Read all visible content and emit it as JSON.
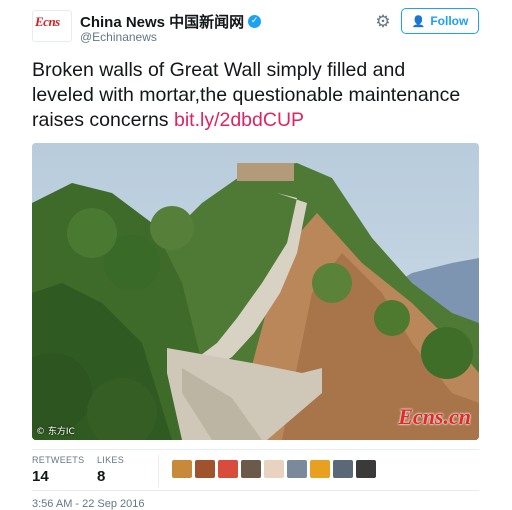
{
  "tweet": {
    "author": {
      "avatar_text": "Ecns",
      "display_name": "China News 中国新闻网",
      "handle": "@Echinanews",
      "verified_icon": "✓"
    },
    "follow_label": "Follow",
    "text": "Broken walls of Great Wall simply filled and leveled with mortar,the questionable maintenance raises concerns ",
    "link": "bit.ly/2dbdCUP",
    "photo": {
      "watermark_left": "© 东方IC",
      "watermark_right": "Ecns.cn"
    },
    "stats": {
      "retweets_label": "RETWEETS",
      "retweets_value": "14",
      "likes_label": "LIKES",
      "likes_value": "8"
    },
    "timestamp": "3:56 AM - 22 Sep 2016"
  },
  "icons": {
    "settings": "gear-icon",
    "follow": "add-user-icon",
    "verified": "verified-badge-icon"
  },
  "colors": {
    "accent": "#1da1f2",
    "link": "#e0245e",
    "text": "#14171a",
    "muted": "#657786"
  },
  "likers": [
    {
      "color": "#c88a3a"
    },
    {
      "color": "#a0522d"
    },
    {
      "color": "#d94b3a"
    },
    {
      "color": "#6b5a4a"
    },
    {
      "color": "#e8d2c0"
    },
    {
      "color": "#7a8a9a"
    },
    {
      "color": "#e8a020"
    },
    {
      "color": "#5a6878"
    },
    {
      "color": "#3a3a3a"
    }
  ]
}
